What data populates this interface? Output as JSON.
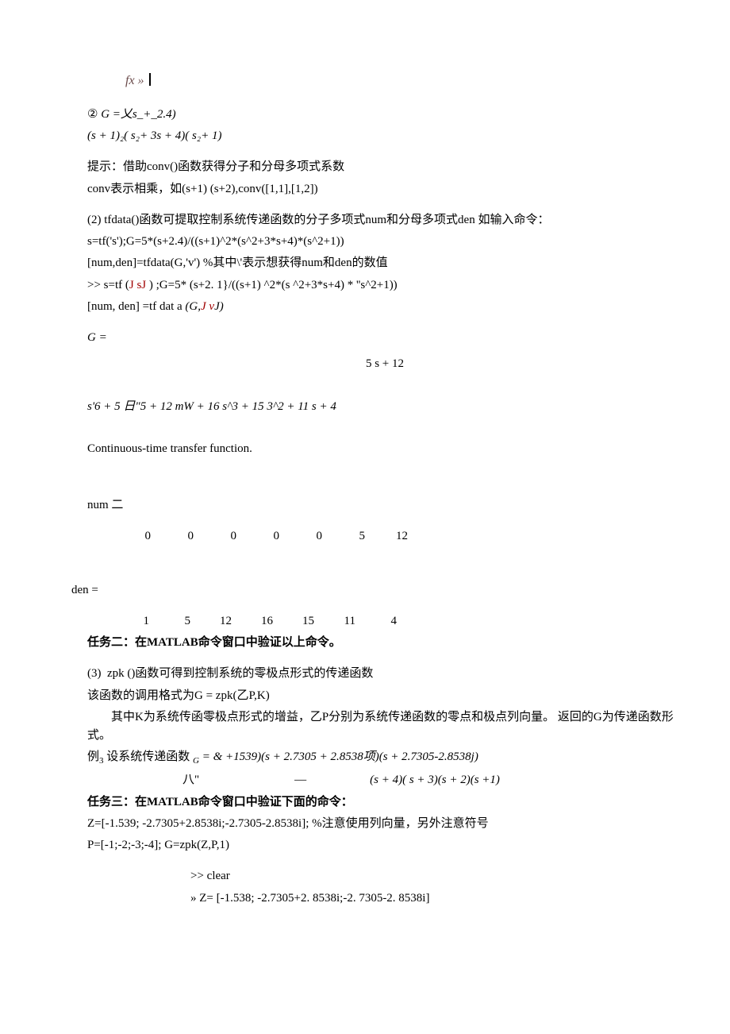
{
  "fx_prefix": "fx » ",
  "sec2_label": "②",
  "sec2_expr1": "G =乂s_+_2.4)",
  "sec2_expr2": "(s + 1)₂( s₂+ 3s + 4)( s₂+ 1)",
  "hint1": "提示：借助conv()函数获得分子和分母多项式系数",
  "hint2": "conv表示相乘，如(s+1) (s+2),conv([1,1],[1,2])",
  "sec3_label": "(2)",
  "sec3_line1": "tfdata()函数可提取控制系统传递函数的分子多项式num和分母多项式den 如输入命令：",
  "sec3_code1": "s=tf('s');G=5*(s+2.4)/((s+1)^2*(s^2+3*s+4)*(s^2+1))",
  "sec3_code2": "[num,den]=tfdata(G,'v') %其中\\'表示想获得num和den的数值",
  "sec3_code3_pre": ">> s=tf (",
  "sec3_code3_in": "J sJ",
  "sec3_code3_post": " ) ;G=5* (s+2. 1}/((s+1) ^2*(s ^2+3*s+4) * ''s^2+1))",
  "sec3_code4_pre": "[num, den] =tf dat a ",
  "sec3_code4_in": "(G,J vJ)",
  "g_label": "G =",
  "tf_num": "5 s + 12",
  "tf_den": "s'6 + 5 日\"5 + 12 mW + 16 s^3 + 15 3^2 + 11 s + 4",
  "ct_label": "Continuous-time transfer function.",
  "num_label": "num 二",
  "num_row": [
    "0",
    "0",
    "0",
    "0",
    "0",
    "5",
    "12"
  ],
  "den_label": "den =",
  "den_row": [
    "1",
    "5",
    "12",
    "16",
    "15",
    "11",
    "4"
  ],
  "task2": "任务二：在MATLAB命令窗口中验证以上命令。",
  "sec4_label": "(3)",
  "sec4_line1": "zpk ()函数可得到控制系统的零极点形式的传递函数",
  "sec4_line2": "该函数的调用格式为G = zpk(乙P,K)",
  "sec4_para": "其中K为系统传函零极点形式的增益，乙P分别为系统传递函数的零点和极点列向量。 返回的G为传递函数形式。",
  "ex3_pre": "例",
  "ex3_sub": "3",
  "ex3_text": " 设系统传递函数 ",
  "ex3_g": "G",
  "ex3_eq": " = & +1539)(s + 2.7305 + 2.8538项)(s + 2.7305-2.8538j)",
  "ex3_line2a": "八\"",
  "ex3_line2b": "—",
  "ex3_line2c": "(s + 4)( s + 3)(s + 2)(s +1)",
  "task3": "任务三：在MATLAB命令窗口中验证下面的命令：",
  "z_line": "Z=[-1.539; -2.7305+2.8538i;-2.7305-2.8538i]; %注意使用列向量，另外注意符号",
  "p_line": "P=[-1;-2;-3;-4]; G=zpk(Z,P,1)",
  "clear_line": ">> clear",
  "z2_line": "» Z= [-1.538; -2.7305+2. 8538i;-2. 7305-2. 8538i]"
}
